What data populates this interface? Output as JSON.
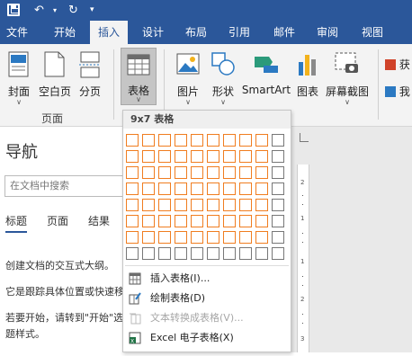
{
  "quick_access": {
    "save_icon": "save-icon",
    "undo_icon": "undo-icon",
    "redo_icon": "redo-icon",
    "dropdown_icon": "dropdown-icon"
  },
  "tabs": [
    "文件",
    "开始",
    "插入",
    "设计",
    "布局",
    "引用",
    "邮件",
    "审阅",
    "视图"
  ],
  "active_tab": "插入",
  "ribbon": {
    "pages_group": {
      "label": "页面",
      "buttons": [
        "封面",
        "空白页",
        "分页"
      ]
    },
    "table_button": "表格",
    "illustrations": [
      "图片",
      "形状",
      "SmartArt",
      "图表",
      "屏幕截图"
    ],
    "cut_labels": [
      "获",
      "我"
    ]
  },
  "nav_pane": {
    "title": "导航",
    "search_placeholder": "在文档中搜索",
    "tabs": [
      "标题",
      "页面",
      "结果"
    ],
    "lines": [
      "创建文档的交互式大纲。",
      "它是跟踪具体位置或快速移",
      "若要开始，请转到\"开始\"选",
      "题样式。"
    ]
  },
  "table_menu": {
    "header": "9x7 表格",
    "grid_cols": 10,
    "grid_rows": 8,
    "selected_cols": 9,
    "selected_rows": 7,
    "items": [
      {
        "label": "插入表格(I)...",
        "enabled": true,
        "icon": "insert-table-icon"
      },
      {
        "label": "绘制表格(D)",
        "enabled": true,
        "icon": "draw-table-icon"
      },
      {
        "label": "文本转换成表格(V)...",
        "enabled": false,
        "icon": "text-to-table-icon"
      },
      {
        "label": "Excel 电子表格(X)",
        "enabled": true,
        "icon": "excel-icon"
      }
    ]
  },
  "colors": {
    "titlebar": "#2b579a",
    "ribbon": "#f3f3f3",
    "grid_selected": "#f07d20",
    "excel": "#217346"
  }
}
